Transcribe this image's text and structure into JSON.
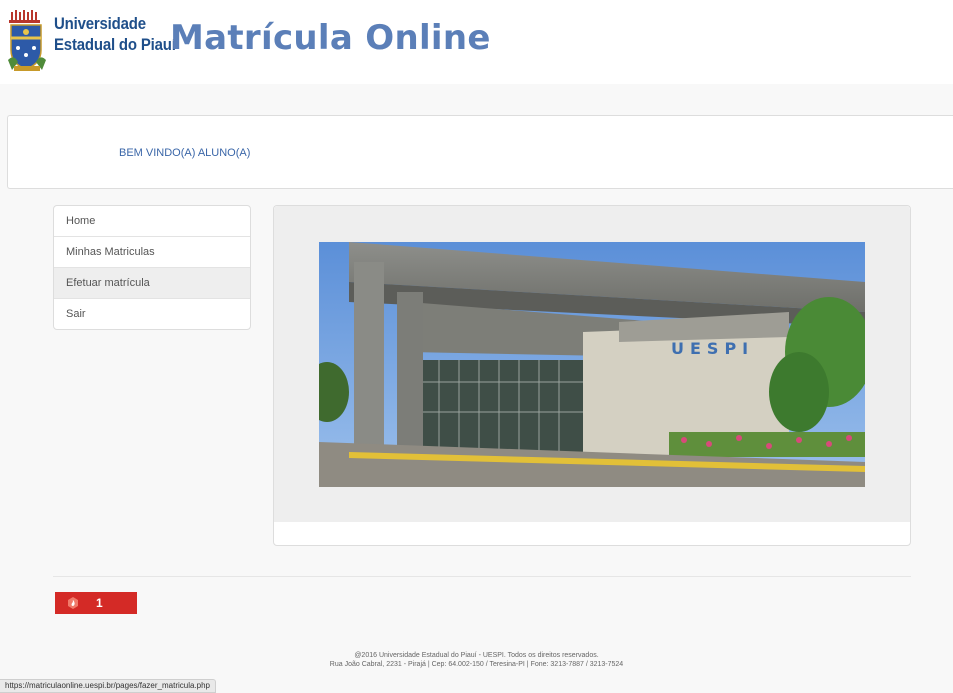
{
  "header": {
    "logo_line1": "Universidade",
    "logo_line2": "Estadual do Piauí",
    "title": "Matrícula Online"
  },
  "welcome": {
    "text": "BEM VINDO(A) ALUNO(A)"
  },
  "nav": {
    "items": [
      {
        "label": "Home"
      },
      {
        "label": "Minhas Matriculas"
      },
      {
        "label": "Efetuar matrícula"
      },
      {
        "label": "Sair"
      }
    ]
  },
  "main": {
    "image_text": "UESPI"
  },
  "notification": {
    "icon": "flame-icon",
    "count": "1"
  },
  "footer": {
    "line1": "@2016 Universidade Estadual do Piauí - UESPI. Todos os direitos reservados.",
    "line2": "Rua João Cabral, 2231 - Pirajá | Cep: 64.002-150 / Teresina-PI | Fone: 3213-7887 / 3213-7524"
  },
  "status_bar": {
    "url": "https://matriculaonline.uespi.br/pages/fazer_matricula.php"
  },
  "colors": {
    "brand_blue": "#1f4f8a",
    "title_blue": "#5b7fb8",
    "badge_red": "#d42a26"
  }
}
